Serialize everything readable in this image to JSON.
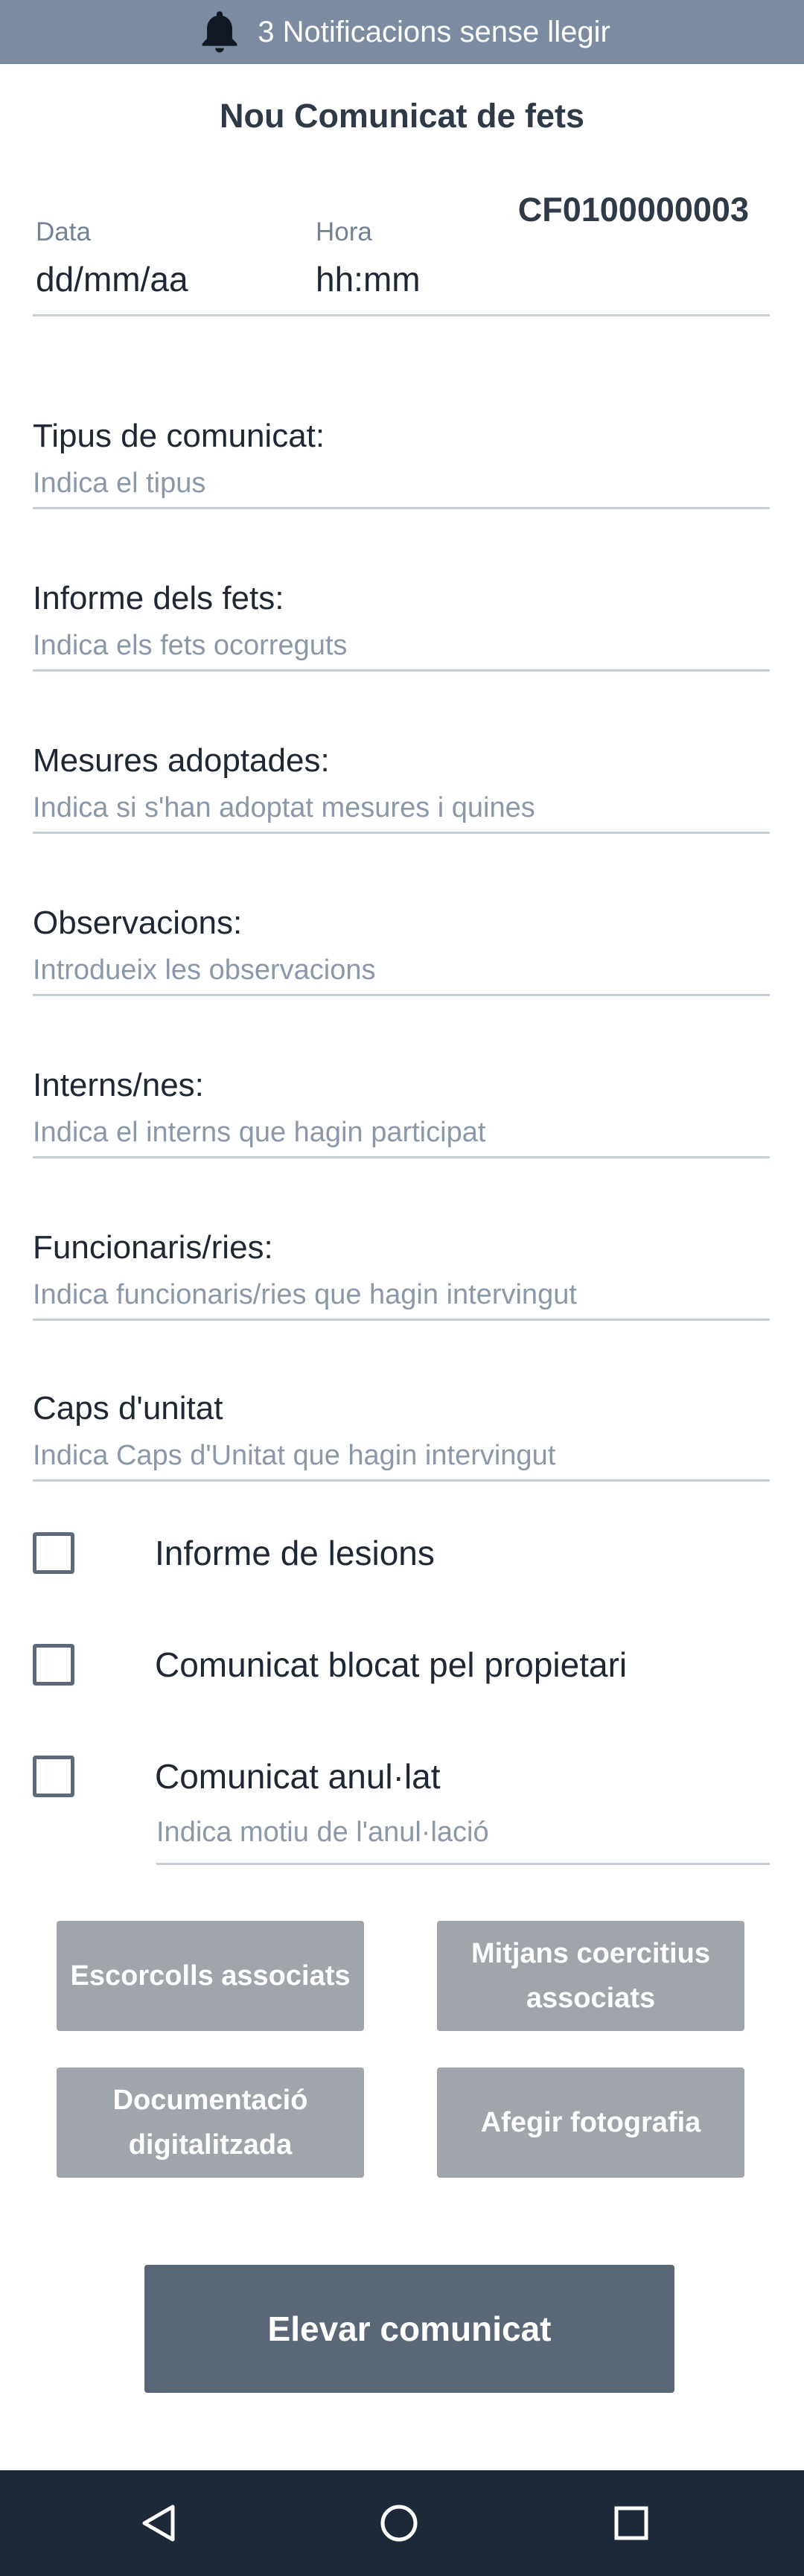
{
  "status": {
    "notifications_text": "3 Notificacions sense llegir"
  },
  "header": {
    "title": "Nou Comunicat de fets"
  },
  "record": {
    "code": "CF0100000003"
  },
  "date": {
    "label": "Data",
    "value": "dd/mm/aa"
  },
  "time": {
    "label": "Hora",
    "value": "hh:mm"
  },
  "fields": [
    {
      "label": "Tipus de comunicat:",
      "placeholder": "Indica el tipus"
    },
    {
      "label": "Informe dels fets:",
      "placeholder": "Indica els fets ocorreguts"
    },
    {
      "label": "Mesures adoptades:",
      "placeholder": "Indica si s'han adoptat mesures i quines"
    },
    {
      "label": "Observacions:",
      "placeholder": "Introdueix les observacions"
    },
    {
      "label": "Interns/nes:",
      "placeholder": "Indica el interns que hagin participat"
    },
    {
      "label": "Funcionaris/ries:",
      "placeholder": "Indica funcionaris/ries que hagin intervingut"
    },
    {
      "label": "Caps d'unitat",
      "placeholder": "Indica Caps d'Unitat que hagin intervingut"
    }
  ],
  "checkboxes": [
    {
      "label": "Informe de lesions",
      "checked": false
    },
    {
      "label": "Comunicat blocat pel propietari",
      "checked": false
    },
    {
      "label": "Comunicat anul·lat",
      "checked": false
    }
  ],
  "annulment": {
    "placeholder": "Indica motiu de l'anul·lació"
  },
  "actions": {
    "searches": "Escorcolls associats",
    "coercive": "Mitjans coercitius associats",
    "docs": "Documentació digitalitzada",
    "photo": "Afegir fotografia",
    "submit": "Elevar comunicat"
  },
  "colors": {
    "notification_bar": "#7c8ba0",
    "secondary_button": "#a0a5ab",
    "primary_button": "#5a6776",
    "nav_bar": "#1d2939"
  },
  "icons": {
    "notification": "bell-icon",
    "nav_back": "back-triangle-icon",
    "nav_home": "home-circle-icon",
    "nav_recents": "recents-square-icon"
  }
}
